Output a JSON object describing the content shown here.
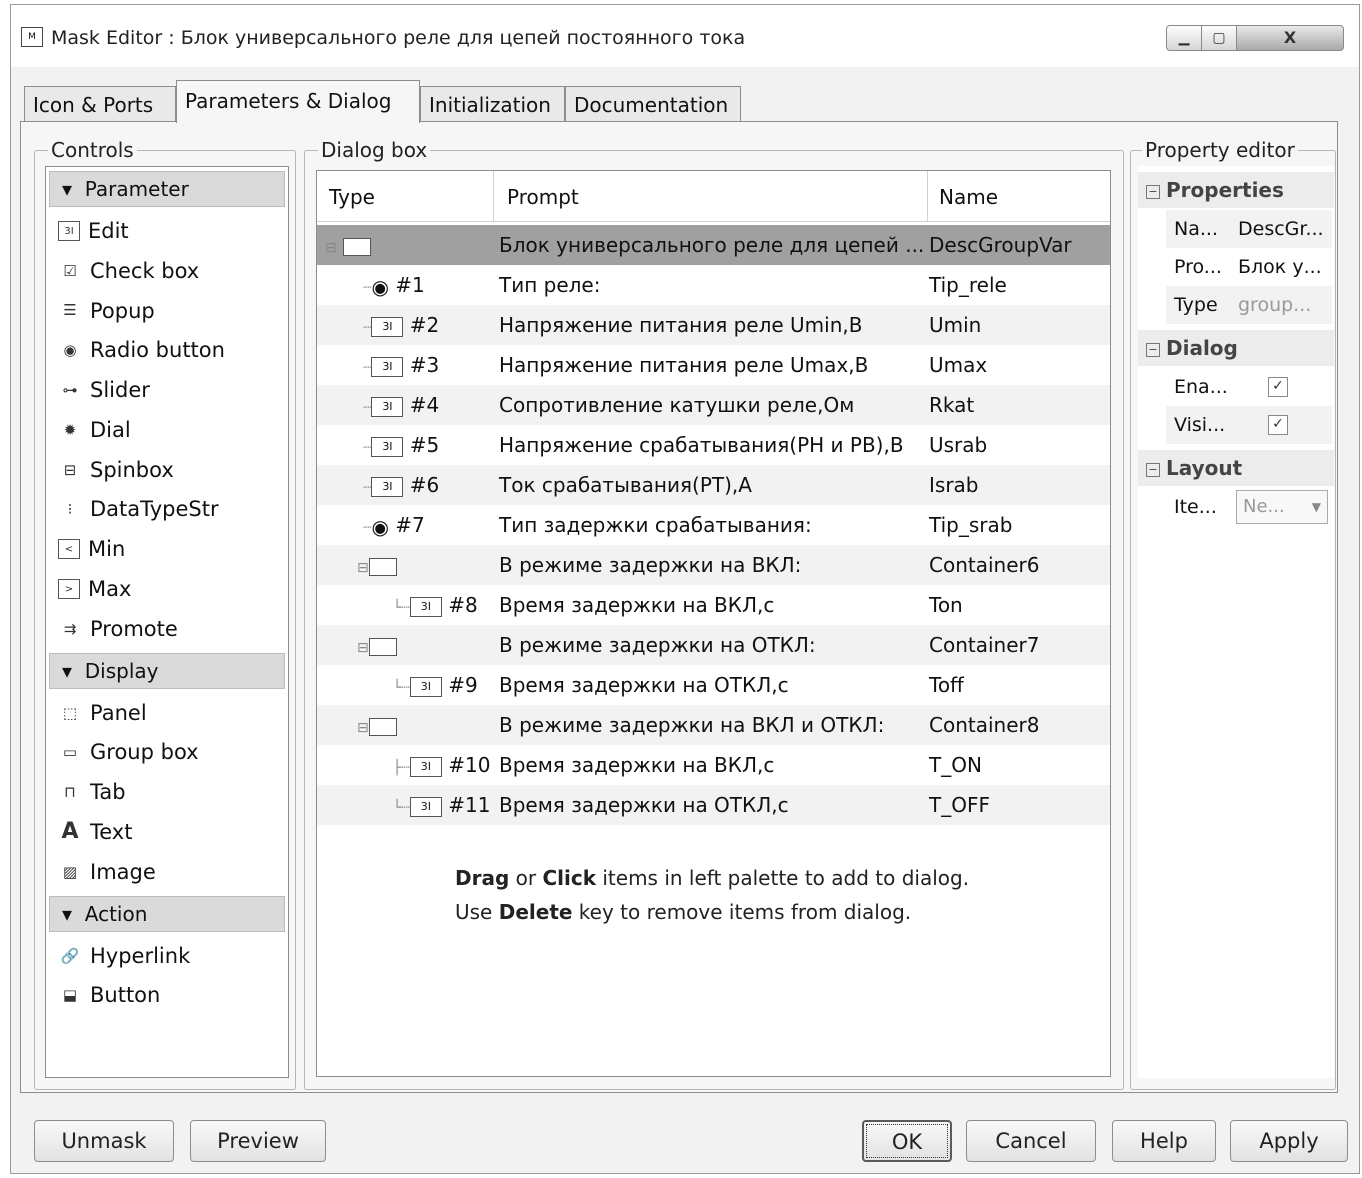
{
  "window": {
    "title": "Mask Editor : Блок универсального реле для цепей постоянного тока",
    "icon": "mask-editor-icon",
    "controls": {
      "minimize": "▁",
      "maximize": "▢",
      "close": "X"
    }
  },
  "tabs": [
    {
      "label": "Icon & Ports"
    },
    {
      "label": "Parameters & Dialog",
      "active": true
    },
    {
      "label": "Initialization"
    },
    {
      "label": "Documentation"
    }
  ],
  "controls_panel": {
    "title": "Controls",
    "sections": [
      {
        "header": "Parameter",
        "items": [
          "Edit",
          "Check box",
          "Popup",
          "Radio button",
          "Slider",
          "Dial",
          "Spinbox",
          "DataTypeStr",
          "Min",
          "Max",
          "Promote"
        ]
      },
      {
        "header": "Display",
        "items": [
          "Panel",
          "Group box",
          "Tab",
          "Text",
          "Image"
        ]
      },
      {
        "header": "Action",
        "items": [
          "Hyperlink",
          "Button"
        ]
      }
    ]
  },
  "dialog_box": {
    "title": "Dialog box",
    "columns": {
      "type": "Type",
      "prompt": "Prompt",
      "name": "Name"
    },
    "rows": [
      {
        "type": "",
        "prompt": "Блок универсального реле для цепей ...",
        "name": "DescGroupVar"
      },
      {
        "type": "#1",
        "prompt": "Тип реле:",
        "name": "Tip_rele"
      },
      {
        "type": "#2",
        "prompt": "Напряжение питания реле Umin,В",
        "name": "Umin"
      },
      {
        "type": "#3",
        "prompt": "Напряжение питания реле Umax,В",
        "name": "Umax"
      },
      {
        "type": "#4",
        "prompt": "Сопротивление катушки реле,Ом",
        "name": "Rkat"
      },
      {
        "type": "#5",
        "prompt": "Напряжение срабатывания(РН и РВ),В",
        "name": "Usrab"
      },
      {
        "type": "#6",
        "prompt": "Ток срабатывания(РТ),А",
        "name": "Israb"
      },
      {
        "type": "#7",
        "prompt": "Тип задержки срабатывания:",
        "name": "Tip_srab"
      },
      {
        "type": "",
        "prompt": "В режиме задержки на ВКЛ:",
        "name": "Container6"
      },
      {
        "type": "#8",
        "prompt": "Время задержки на ВКЛ,с",
        "name": "Ton"
      },
      {
        "type": "",
        "prompt": "В режиме задержки на ОТКЛ:",
        "name": "Container7"
      },
      {
        "type": "#9",
        "prompt": "Время задержки на ОТКЛ,с",
        "name": "Toff"
      },
      {
        "type": "",
        "prompt": "В режиме задержки на ВКЛ и ОТКЛ:",
        "name": "Container8"
      },
      {
        "type": "#10",
        "prompt": "Время задержки на ВКЛ,с",
        "name": "T_ON"
      },
      {
        "type": "#11",
        "prompt": "Время задержки на ОТКЛ,с",
        "name": "T_OFF"
      }
    ],
    "hint": {
      "l1a": "Drag",
      "l1b": " or ",
      "l1c": "Click",
      "l1d": " items in left palette to add to dialog.",
      "l2a": "Use ",
      "l2b": "Delete",
      "l2c": " key to remove items from dialog."
    }
  },
  "property_editor": {
    "title": "Property editor",
    "properties_header": "Properties",
    "properties": [
      {
        "key": "Na...",
        "value": "DescGr..."
      },
      {
        "key": "Pro...",
        "value": "Блок у..."
      },
      {
        "key": "Type",
        "value": "group..."
      }
    ],
    "dialog_header": "Dialog",
    "dialog": [
      {
        "key": "Ena...",
        "checked": true
      },
      {
        "key": "Visi...",
        "checked": true
      }
    ],
    "layout_header": "Layout",
    "layout": [
      {
        "key": "Ite...",
        "value": "Ne..."
      }
    ]
  },
  "buttons": {
    "unmask": "Unmask",
    "preview": "Preview",
    "ok": "OK",
    "cancel": "Cancel",
    "help": "Help",
    "apply": "Apply"
  }
}
